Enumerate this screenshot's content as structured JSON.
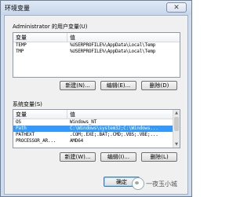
{
  "window": {
    "title": "环境变量",
    "close_glyph": "✕"
  },
  "user_vars": {
    "label": "Administrator 的用户变量(U)",
    "headers": {
      "name": "变量",
      "value": "值"
    },
    "rows": [
      {
        "name": "TEMP",
        "value": "%USERPROFILE%\\AppData\\Local\\Temp"
      },
      {
        "name": "TMP",
        "value": "%USERPROFILE%\\AppData\\Local\\Temp"
      }
    ],
    "buttons": {
      "new": "新建(N)...",
      "edit": "编辑(E)...",
      "delete": "删除(D)"
    }
  },
  "system_vars": {
    "label": "系统变量(S)",
    "headers": {
      "name": "变量",
      "value": "值"
    },
    "rows": [
      {
        "name": "OS",
        "value": "Windows_NT"
      },
      {
        "name": "Path",
        "value": "C:\\Windows\\system32;C:\\Windows..."
      },
      {
        "name": "PATHEXT",
        "value": ".COM;.EXE;.BAT;.CMD;.VBS;.VBE;..."
      },
      {
        "name": "PROCESSOR_AR...",
        "value": "AMD64"
      }
    ],
    "selected_index": 1,
    "buttons": {
      "new": "新建(W)...",
      "edit": "编辑(I)...",
      "delete": "删除(L)"
    }
  },
  "footer": {
    "ok": "确定"
  },
  "watermark": {
    "text": "一夜玉小城"
  }
}
